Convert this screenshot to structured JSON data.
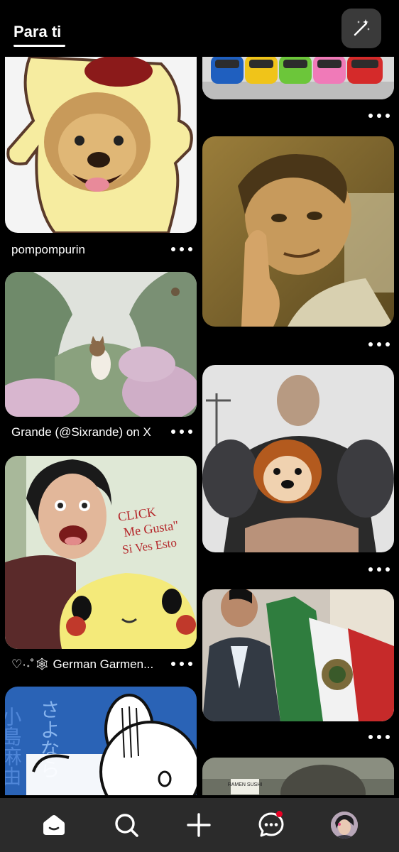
{
  "header": {
    "active_tab": "Para ti",
    "magic_button_icon": "magic-wand-icon"
  },
  "pins": [
    {
      "id": "cars",
      "title": ""
    },
    {
      "id": "pompompurin",
      "title": "pompompurin"
    },
    {
      "id": "man-thinking",
      "title": ""
    },
    {
      "id": "cat-forest",
      "title": "Grande (@Sixrande) on X"
    },
    {
      "id": "man-puppies",
      "title": ""
    },
    {
      "id": "pikachu-guy",
      "title": "♡·˖˚🕸 German Garmen..."
    },
    {
      "id": "mexico-flag",
      "title": ""
    },
    {
      "id": "japanese-text",
      "title": ""
    },
    {
      "id": "ramen-sushi",
      "title": ""
    }
  ],
  "image_text": {
    "click_note": [
      "CLICK",
      "Me Gusta\"",
      "Si Ves Esto"
    ],
    "japanese_left": "小島麻由",
    "japanese_right": "さよなら",
    "ramen_sign": "RAMEN SUSHI"
  },
  "nav": {
    "items": [
      "home-icon",
      "search-icon",
      "plus-icon",
      "messages-icon",
      "profile-avatar"
    ],
    "notification_color": "#e60023"
  }
}
